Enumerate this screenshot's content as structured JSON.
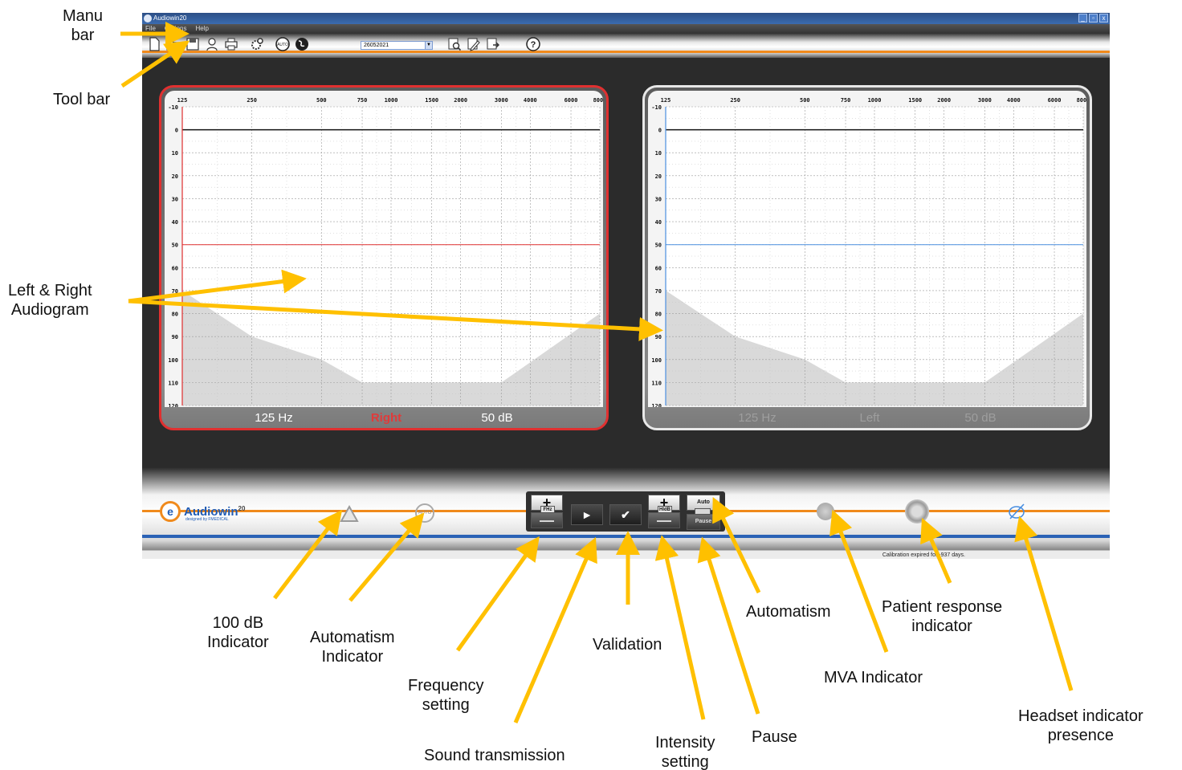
{
  "window": {
    "title": "Audiowin20",
    "controls": [
      "_",
      "▫",
      "x"
    ]
  },
  "menu": [
    "File",
    "Options",
    "Help"
  ],
  "toolbar": {
    "patient_select_value": "26052021",
    "icons": [
      "new-file-icon",
      "open-folder-icon",
      "save-icon",
      "patient-icon",
      "print-icon",
      "settings-icon",
      "auto-icon",
      "globe-icon",
      "zoom-icon",
      "edit-icon",
      "export-icon",
      "help-icon"
    ]
  },
  "audiogram": {
    "freq_labels": [
      "125",
      "250",
      "500",
      "750",
      "1000",
      "1500",
      "2000",
      "3000",
      "4000",
      "6000",
      "8000"
    ],
    "db_labels": [
      "-10",
      "0",
      "10",
      "20",
      "30",
      "40",
      "50",
      "60",
      "70",
      "80",
      "90",
      "100",
      "110",
      "120"
    ],
    "right": {
      "freq_label": "125 Hz",
      "ear_label": "Right",
      "intensity_label": "50 dB",
      "line_db": 50,
      "color": "#e03030"
    },
    "left": {
      "freq_label": "125 Hz",
      "ear_label": "Left",
      "intensity_label": "50 dB",
      "line_db": 50,
      "color": "#4a8fe0"
    }
  },
  "bottom": {
    "brand_name": "Audiowin",
    "brand_version": "20",
    "brand_sub": "designed by FMEDICAL",
    "status_text": "Calibration expired for -937 days.",
    "controls": {
      "freq_plus": "+",
      "freq_label": "FHz",
      "freq_minus": "—",
      "play": "►",
      "validate": "✔",
      "int_plus": "+",
      "int_label": "HldB",
      "int_minus": "—",
      "auto": "Auto",
      "pause": "Pause"
    },
    "auto_indicator": "AUTO"
  },
  "callouts": {
    "menu_bar": "Manu\nbar",
    "tool_bar": "Tool bar",
    "audiogram": "Left & Right\nAudiogram",
    "db100": "100 dB\nIndicator",
    "auto_ind": "Automatism\nIndicator",
    "frequency": "Frequency\nsetting",
    "sound": "Sound transmission",
    "validation": "Validation",
    "intensity": "Intensity\nsetting",
    "pause": "Pause",
    "automatism": "Automatism",
    "mva": "MVA Indicator",
    "patient": "Patient response\nindicator",
    "headset": "Headset indicator\npresence"
  },
  "colors": {
    "accent_orange": "#f08a1c",
    "callout_arrow": "#ffc000",
    "right_ear": "#e03030",
    "left_ear": "#4a8fe0"
  }
}
